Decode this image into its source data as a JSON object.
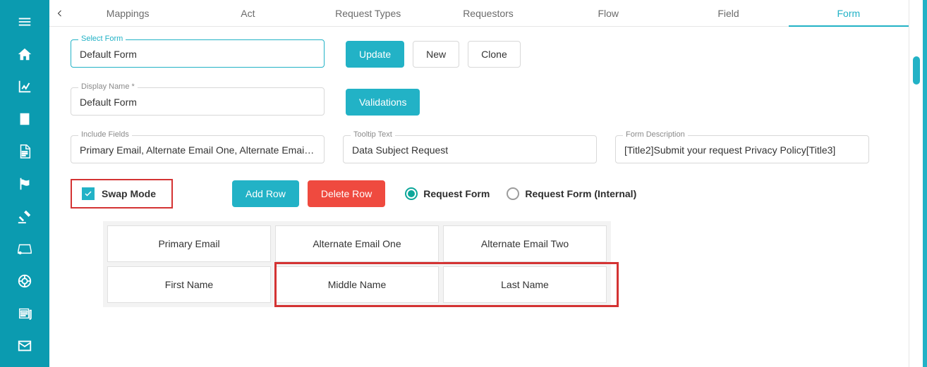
{
  "sidebar": {
    "items": [
      {
        "name": "menu-icon"
      },
      {
        "name": "home-icon"
      },
      {
        "name": "chart-icon"
      },
      {
        "name": "building-icon"
      },
      {
        "name": "file-icon"
      },
      {
        "name": "flag-icon"
      },
      {
        "name": "gavel-icon"
      },
      {
        "name": "drive-icon"
      },
      {
        "name": "life-ring-icon"
      },
      {
        "name": "news-icon"
      },
      {
        "name": "envelope-icon"
      }
    ]
  },
  "tabs": {
    "items": [
      "Mappings",
      "Act",
      "Request Types",
      "Requestors",
      "Flow",
      "Field",
      "Form"
    ],
    "active": 6
  },
  "select_form": {
    "label": "Select Form",
    "value": "Default Form"
  },
  "buttons": {
    "update": "Update",
    "new": "New",
    "clone": "Clone",
    "validations": "Validations",
    "add_row": "Add Row",
    "delete_row": "Delete Row"
  },
  "display_name": {
    "label": "Display Name *",
    "value": "Default Form"
  },
  "include_fields": {
    "label": "Include Fields",
    "value": "Primary Email, Alternate Email One, Alternate Emai…"
  },
  "tooltip_text": {
    "label": "Tooltip Text",
    "value": "Data Subject Request"
  },
  "form_description": {
    "label": "Form Description",
    "value": "[Title2]Submit your request Privacy Policy[Title3]"
  },
  "swap_mode": {
    "label": "Swap Mode",
    "checked": true
  },
  "radios": {
    "option1": "Request Form",
    "option2": "Request Form (Internal)",
    "selected": 0
  },
  "grid": {
    "rows": [
      [
        "Primary Email",
        "Alternate Email One",
        "Alternate Email Two"
      ],
      [
        "First Name",
        "Middle Name",
        "Last Name"
      ]
    ]
  },
  "colors": {
    "accent": "#22b2c6",
    "danger": "#ef4a3f",
    "highlight": "#d43333",
    "teal": "#0da79a"
  }
}
